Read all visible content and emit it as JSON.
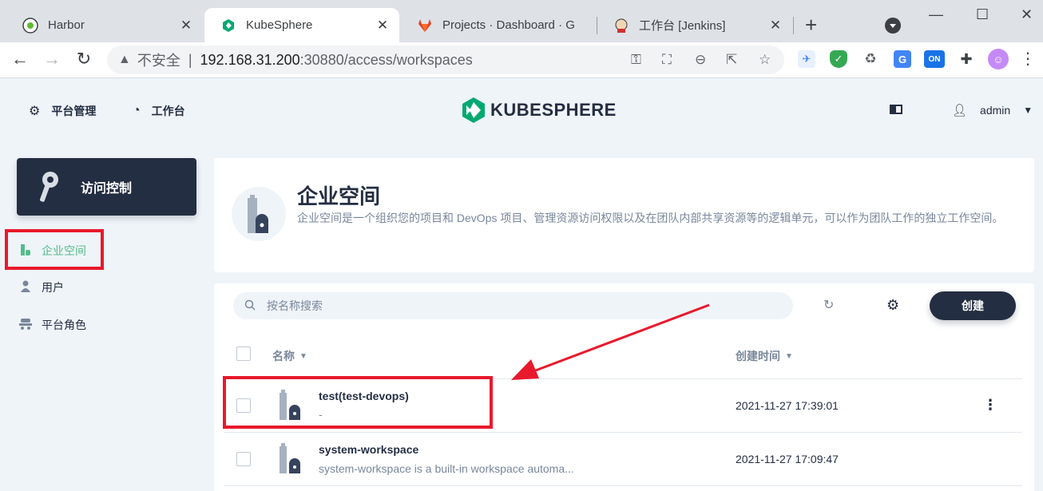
{
  "browser": {
    "tabs": [
      {
        "title": "Harbor"
      },
      {
        "title": "KubeSphere"
      },
      {
        "title": "Projects · Dashboard · G"
      },
      {
        "title": "工作台 [Jenkins]"
      }
    ],
    "address": {
      "insecure_label": "不安全",
      "host": "192.168.31.200",
      "path": ":30880/access/workspaces"
    }
  },
  "header": {
    "platform_label": "平台管理",
    "workbench_label": "工作台",
    "logo_text": "KUBESPHERE",
    "user_name": "admin"
  },
  "sidebar": {
    "card_title": "访问控制",
    "items": [
      {
        "label": "企业空间"
      },
      {
        "label": "用户"
      },
      {
        "label": "平台角色"
      }
    ]
  },
  "banner": {
    "title": "企业空间",
    "description": "企业空间是一个组织您的项目和 DevOps 项目、管理资源访问权限以及在团队内部共享资源等的逻辑单元，可以作为团队工作的独立工作空间。"
  },
  "list": {
    "search_placeholder": "按名称搜索",
    "create_label": "创建",
    "columns": {
      "name": "名称",
      "created": "创建时间"
    },
    "rows": [
      {
        "name": "test(test-devops)",
        "description": "-",
        "created": "2021-11-27 17:39:01"
      },
      {
        "name": "system-workspace",
        "description": "system-workspace is a built-in workspace automa...",
        "created": "2021-11-27 17:09:47"
      }
    ]
  },
  "colors": {
    "accent": "#55bc8a",
    "dark": "#242e42",
    "annotation": "#e8192c"
  }
}
